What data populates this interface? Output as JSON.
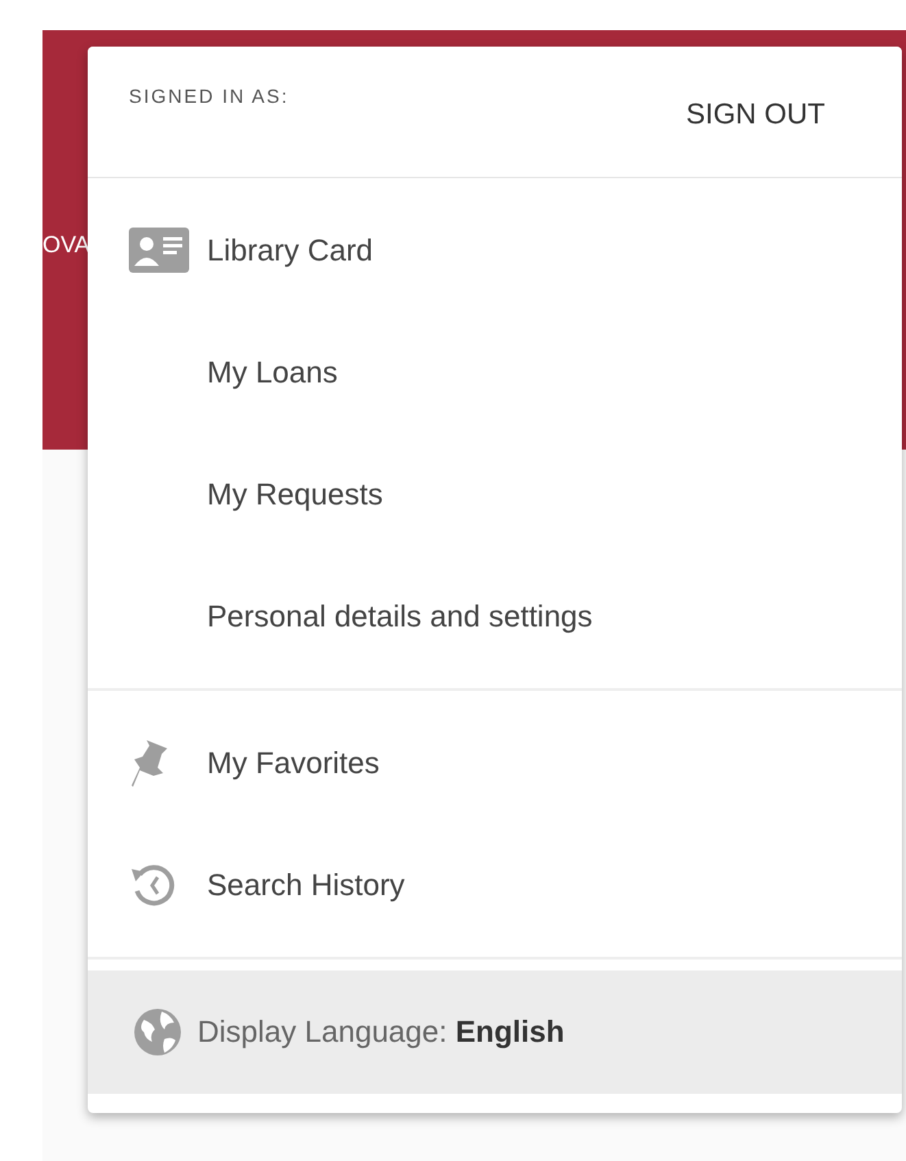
{
  "banner": {
    "text": "OVA"
  },
  "menu": {
    "signed_in_label": "SIGNED IN AS:",
    "sign_out": "SIGN OUT",
    "sections": [
      {
        "items": [
          {
            "label": "Library Card",
            "kind": "card"
          },
          {
            "label": "My Loans",
            "kind": "sub"
          },
          {
            "label": "My Requests",
            "kind": "sub"
          },
          {
            "label": "Personal details and settings",
            "kind": "sub"
          }
        ]
      },
      {
        "items": [
          {
            "label": "My Favorites",
            "kind": "pin"
          },
          {
            "label": "Search History",
            "kind": "history"
          }
        ]
      }
    ],
    "language": {
      "label": "Display Language:",
      "value": "English",
      "highlighted": true
    }
  }
}
